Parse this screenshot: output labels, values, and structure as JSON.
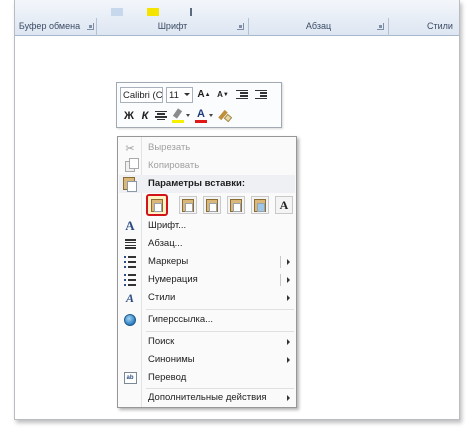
{
  "ribbon": {
    "groups": [
      {
        "label": "Буфер обмена"
      },
      {
        "label": "Шрифт"
      },
      {
        "label": "Абзац"
      },
      {
        "label": "Стили"
      }
    ]
  },
  "mini_toolbar": {
    "font_name": "Calibri (С",
    "font_size": "11",
    "grow_font": "A",
    "shrink_font": "A",
    "bold": "Ж",
    "italic": "К",
    "font_color_glyph": "A",
    "colors": {
      "highlight": "#f7f000",
      "font_color": "#e01818"
    }
  },
  "context_menu": {
    "cut": "Вырезать",
    "copy": "Копировать",
    "paste_options_header": "Параметры вставки:",
    "paste_text_only_glyph": "A",
    "font": "Шрифт...",
    "paragraph": "Абзац...",
    "bullets": "Маркеры",
    "numbering": "Нумерация",
    "styles": "Стили",
    "hyperlink": "Гиперссылка...",
    "search": "Поиск",
    "synonyms": "Синонимы",
    "translate": "Перевод",
    "more_actions": "Дополнительные действия"
  },
  "accent": {
    "selection_border": "#d2141a"
  }
}
